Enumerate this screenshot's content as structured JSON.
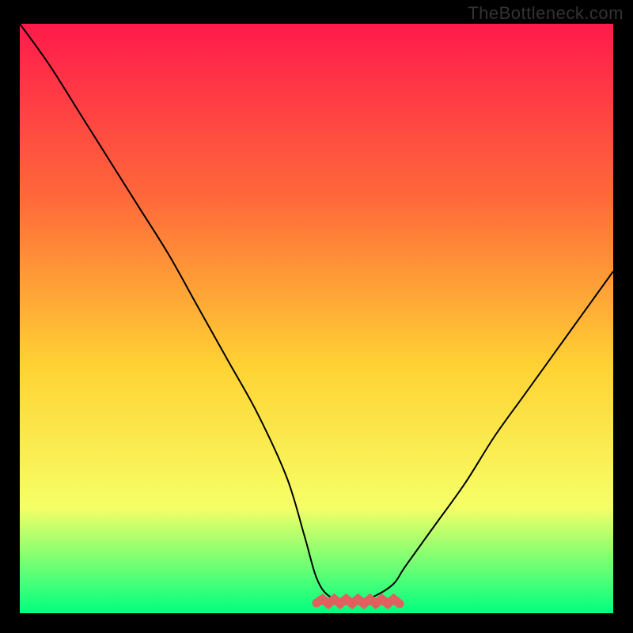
{
  "watermark": "TheBottleneck.com",
  "colors": {
    "background": "#000000",
    "gradient_top": "#ff1a4b",
    "gradient_upper_mid": "#ff6a3a",
    "gradient_mid": "#ffd233",
    "gradient_lower_mid": "#f6ff66",
    "gradient_bottom": "#00ff80",
    "curve": "#000000",
    "highlight": "#e06060"
  },
  "chart_data": {
    "type": "line",
    "title": "",
    "xlabel": "",
    "ylabel": "",
    "xlim": [
      0,
      100
    ],
    "ylim": [
      0,
      100
    ],
    "series": [
      {
        "name": "bottleneck-curve",
        "x": [
          0,
          5,
          10,
          15,
          20,
          25,
          30,
          35,
          40,
          45,
          48,
          50,
          52,
          55,
          57,
          60,
          63,
          65,
          70,
          75,
          80,
          85,
          90,
          95,
          100
        ],
        "values": [
          100,
          93,
          85,
          77,
          69,
          61,
          52,
          43,
          34,
          23,
          13,
          6,
          3,
          2,
          2,
          3,
          5,
          8,
          15,
          22,
          30,
          37,
          44,
          51,
          58
        ]
      }
    ],
    "highlight_region": {
      "name": "optimal-range",
      "x_start": 50,
      "x_end": 64,
      "y": 2
    },
    "annotations": []
  }
}
